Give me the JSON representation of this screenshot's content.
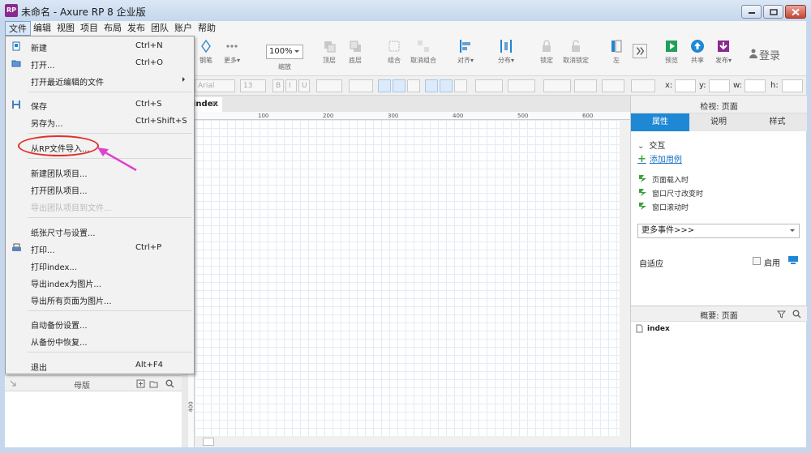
{
  "window": {
    "title": "未命名 - Axure RP 8 企业版",
    "app_icon": "RP"
  },
  "menubar": {
    "items": [
      "文件",
      "编辑",
      "视图",
      "项目",
      "布局",
      "发布",
      "团队",
      "账户",
      "帮助"
    ],
    "active": "文件"
  },
  "toolbar": {
    "zoom_value": "100%",
    "zoom_label": "缩放",
    "tools": [
      {
        "label": "钢笔",
        "icon": "pen-icon"
      },
      {
        "label": "更多▾",
        "icon": "more-dots-icon"
      },
      {
        "label": "顶层",
        "icon": "bring-front-icon"
      },
      {
        "label": "底层",
        "icon": "send-back-icon"
      },
      {
        "label": "组合",
        "icon": "group-icon"
      },
      {
        "label": "取消组合",
        "icon": "ungroup-icon"
      },
      {
        "label": "对齐▾",
        "icon": "align-icon"
      },
      {
        "label": "分布▾",
        "icon": "distribute-icon"
      },
      {
        "label": "锁定",
        "icon": "lock-icon"
      },
      {
        "label": "取消锁定",
        "icon": "unlock-icon"
      },
      {
        "label": "左",
        "icon": "left-panel-icon"
      },
      {
        "label": "预览",
        "icon": "preview-icon"
      },
      {
        "label": "共享",
        "icon": "share-icon"
      },
      {
        "label": "发布▾",
        "icon": "publish-icon"
      }
    ],
    "login": "登录"
  },
  "formatbar": {
    "font": "Arial",
    "size": "13",
    "x_label": "x:",
    "y_label": "y:",
    "w_label": "w:",
    "h_label": "h:"
  },
  "canvas": {
    "tab": "index",
    "ruler_h": [
      "100",
      "200",
      "300",
      "400",
      "500",
      "600"
    ],
    "ruler_v": [
      "400"
    ]
  },
  "left_panel": {
    "masters_title": "母版"
  },
  "right_panel": {
    "inspector_title": "检视: 页面",
    "tabs": [
      "属性",
      "说明",
      "样式"
    ],
    "active_tab": "属性",
    "interaction_section": "交互",
    "add_case": "添加用例",
    "events": [
      "页面载入时",
      "窗口尺寸改变时",
      "窗口滚动时"
    ],
    "more_events": "更多事件>>>",
    "adaptive": "自适应",
    "enable": "启用",
    "outline_title": "概要: 页面",
    "outline_page": "index"
  },
  "file_menu": {
    "items": [
      {
        "label": "新建",
        "shortcut": "Ctrl+N",
        "icon": "new-file-icon",
        "disabled": false
      },
      {
        "label": "打开...",
        "shortcut": "Ctrl+O",
        "icon": "open-folder-icon",
        "disabled": false
      },
      {
        "label": "打开最近编辑的文件",
        "shortcut": "",
        "icon": "",
        "disabled": false,
        "submenu": true
      },
      {
        "label": "保存",
        "shortcut": "Ctrl+S",
        "icon": "save-icon",
        "disabled": false
      },
      {
        "label": "另存为...",
        "shortcut": "Ctrl+Shift+S",
        "icon": "",
        "disabled": false
      },
      {
        "label": "从RP文件导入...",
        "shortcut": "",
        "icon": "",
        "disabled": false
      },
      {
        "label": "新建团队项目...",
        "shortcut": "",
        "icon": "",
        "disabled": false
      },
      {
        "label": "打开团队项目...",
        "shortcut": "",
        "icon": "",
        "disabled": false
      },
      {
        "label": "导出团队项目到文件...",
        "shortcut": "",
        "icon": "",
        "disabled": true
      },
      {
        "label": "纸张尺寸与设置...",
        "shortcut": "",
        "icon": "",
        "disabled": false
      },
      {
        "label": "打印...",
        "shortcut": "Ctrl+P",
        "icon": "print-icon",
        "disabled": false
      },
      {
        "label": "打印index...",
        "shortcut": "",
        "icon": "",
        "disabled": false
      },
      {
        "label": "导出index为图片...",
        "shortcut": "",
        "icon": "",
        "disabled": false
      },
      {
        "label": "导出所有页面为图片...",
        "shortcut": "",
        "icon": "",
        "disabled": false
      },
      {
        "label": "自动备份设置...",
        "shortcut": "",
        "icon": "",
        "disabled": false
      },
      {
        "label": "从备份中恢复...",
        "shortcut": "",
        "icon": "",
        "disabled": false
      },
      {
        "label": "退出",
        "shortcut": "Alt+F4",
        "icon": "",
        "disabled": false
      }
    ]
  },
  "colors": {
    "accent": "#1e88d4",
    "highlight_oval": "#e0302a",
    "pointer_arrow": "#e040d0"
  }
}
